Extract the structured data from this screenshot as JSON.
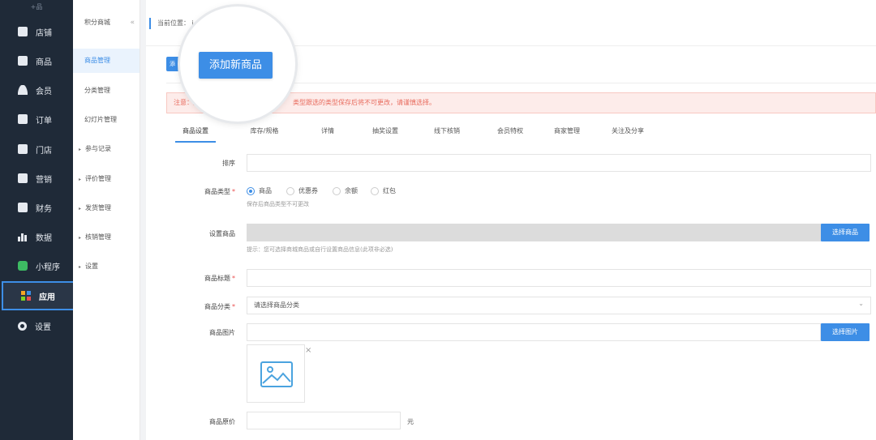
{
  "sidebar": {
    "logo_text": "+品",
    "items": [
      {
        "label": "店铺",
        "icon": "shop-icon"
      },
      {
        "label": "商品",
        "icon": "goods-icon"
      },
      {
        "label": "会员",
        "icon": "member-icon"
      },
      {
        "label": "订单",
        "icon": "order-icon"
      },
      {
        "label": "门店",
        "icon": "store-icon"
      },
      {
        "label": "营销",
        "icon": "marketing-icon"
      },
      {
        "label": "财务",
        "icon": "finance-icon"
      },
      {
        "label": "数据",
        "icon": "data-chart-icon"
      },
      {
        "label": "小程序",
        "icon": "miniprogram-icon"
      },
      {
        "label": "应用",
        "icon": "apps-grid-icon"
      },
      {
        "label": "设置",
        "icon": "gear-icon"
      }
    ],
    "active_index": 9
  },
  "subnav": {
    "title": "积分商城",
    "collapse_glyph": "«",
    "items": [
      {
        "label": "商品管理",
        "expandable": false
      },
      {
        "label": "分类管理",
        "expandable": false
      },
      {
        "label": "幻灯片管理",
        "expandable": false
      },
      {
        "label": "参与记录",
        "expandable": true
      },
      {
        "label": "评价管理",
        "expandable": true
      },
      {
        "label": "发货管理",
        "expandable": true
      },
      {
        "label": "核销管理",
        "expandable": true
      },
      {
        "label": "设置",
        "expandable": true
      }
    ],
    "active_index": 0,
    "arrow_glyph": "▸"
  },
  "breadcrumb": {
    "text": "当前位置：",
    "tail": "i"
  },
  "add_button": {
    "label": "添加新商品",
    "small_label": "添"
  },
  "notice": {
    "prefix": "注意：另",
    "text": "类型跟选的类型保存后将不可更改，请谨慎选择。"
  },
  "tabs": [
    "商品设置",
    "库存/规格",
    "详情",
    "抽奖设置",
    "线下核销",
    "会员特权",
    "商家管理",
    "关注及分享"
  ],
  "active_tab": 0,
  "form": {
    "sort_label": "排序",
    "type_label": "商品类型",
    "type_options": [
      "商品",
      "优惠券",
      "余额",
      "红包"
    ],
    "type_selected": 0,
    "type_hint": "保存后商品类型不可更改",
    "set_goods_label": "设置商品",
    "select_goods_button": "选择商品",
    "set_goods_hint": "提示：您可选择商城商品或自行设置商品信息(此项非必选)",
    "title_label": "商品标题",
    "category_label": "商品分类",
    "category_placeholder": "请选择商品分类",
    "image_label": "商品图片",
    "select_image_button": "选择图片",
    "price_label": "商品原价",
    "price_unit": "元",
    "required_mark": "*",
    "close_glyph": "×",
    "dropdown_glyph": "⌄"
  },
  "colors": {
    "accent": "#3d8ee6",
    "sidebar_bg": "#1f2a38",
    "notice_text": "#e86a5c",
    "notice_bg": "#fdecea"
  }
}
